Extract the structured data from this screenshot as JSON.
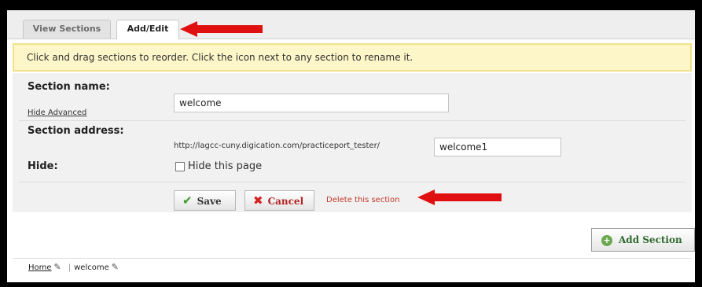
{
  "tabs": [
    {
      "label": "View Sections",
      "active": false
    },
    {
      "label": "Add/Edit",
      "active": true
    }
  ],
  "notice": "Click and drag sections to reorder. Click the icon next to any section to rename it.",
  "form": {
    "section_name_label": "Section name:",
    "section_name_value": "welcome",
    "hide_advanced": "Hide Advanced",
    "section_address_label": "Section address:",
    "address_prefix": "http://lagcc-cuny.digication.com/practiceport_tester/",
    "address_value": "welcome1",
    "hide_label": "Hide:",
    "hide_checkbox_label": "Hide this page",
    "hide_checked": false,
    "save_label": "Save",
    "cancel_label": "Cancel",
    "delete_label": "Delete this section"
  },
  "add_section_label": "Add Section",
  "breadcrumb": {
    "home": "Home",
    "current": "welcome"
  },
  "icons": {
    "save": "checkmark-icon",
    "cancel": "x-icon",
    "add": "plus-circle-icon",
    "edit": "edit-pencil-icon",
    "annotation": "red-arrow"
  },
  "colors": {
    "notice_bg": "#fdf6c8",
    "arrow": "#e01010",
    "delete_link": "#c0392b",
    "add_icon": "#6aa84f"
  }
}
